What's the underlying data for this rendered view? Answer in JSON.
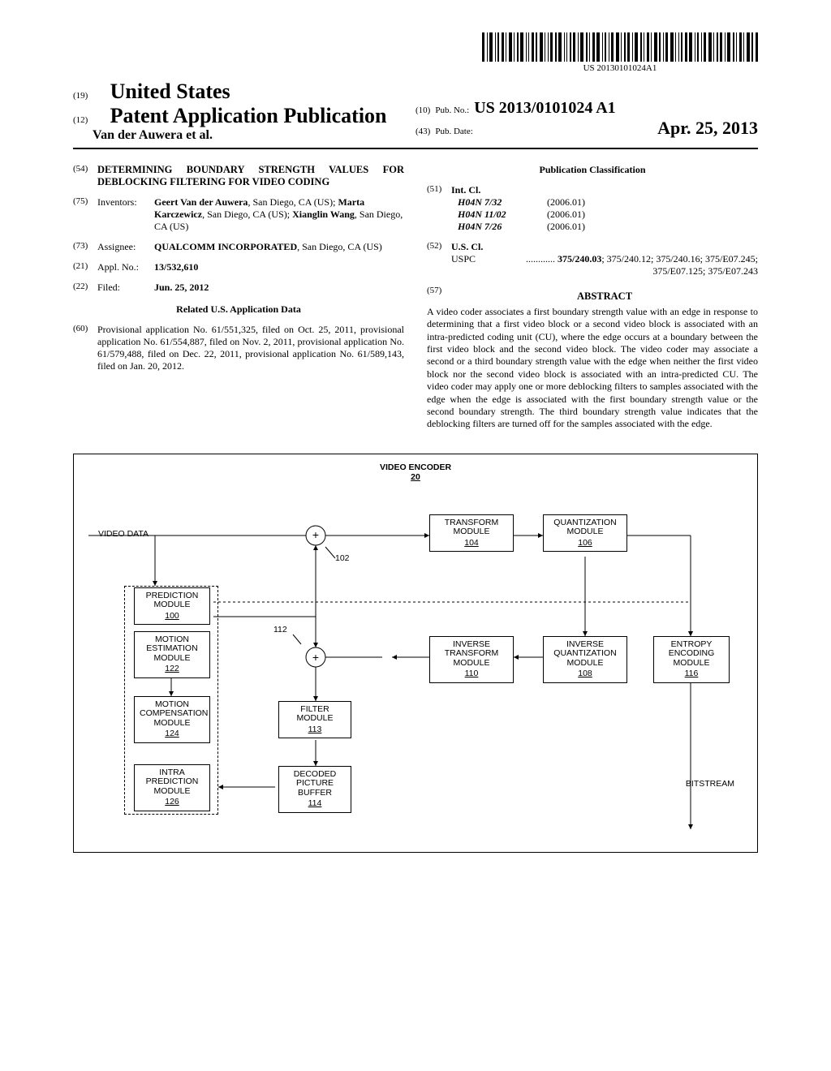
{
  "barcode_text": "US 20130101024A1",
  "header": {
    "idx19": "(19)",
    "us": "United States",
    "idx12": "(12)",
    "pap": "Patent Application Publication",
    "authors": "Van der Auwera et al.",
    "idx10": "(10)",
    "pubno_lbl": "Pub. No.:",
    "pubno": "US 2013/0101024 A1",
    "idx43": "(43)",
    "pubdate_lbl": "Pub. Date:",
    "pubdate": "Apr. 25, 2013"
  },
  "left": {
    "idx54": "(54)",
    "title": "DETERMINING BOUNDARY STRENGTH VALUES FOR DEBLOCKING FILTERING FOR VIDEO CODING",
    "idx75": "(75)",
    "inventors_lbl": "Inventors:",
    "inventors": "Geert Van der Auwera, San Diego, CA (US); Marta Karczewicz, San Diego, CA (US); Xianglin Wang, San Diego, CA (US)",
    "inv_b1": "Geert Van der Auwera",
    "inv_r1": ", San Diego, CA (US); ",
    "inv_b2": "Marta Karczewicz",
    "inv_r2": ", San Diego, CA (US); ",
    "inv_b3": "Xianglin Wang",
    "inv_r3": ", San Diego, CA (US)",
    "idx73": "(73)",
    "assignee_lbl": "Assignee:",
    "assignee_b": "QUALCOMM INCORPORATED",
    "assignee_r": ", San Diego, CA (US)",
    "idx21": "(21)",
    "applno_lbl": "Appl. No.:",
    "applno": "13/532,610",
    "idx22": "(22)",
    "filed_lbl": "Filed:",
    "filed": "Jun. 25, 2012",
    "related_hdr": "Related U.S. Application Data",
    "idx60": "(60)",
    "related": "Provisional application No. 61/551,325, filed on Oct. 25, 2011, provisional application No. 61/554,887, filed on Nov. 2, 2011, provisional application No. 61/579,488, filed on Dec. 22, 2011, provisional application No. 61/589,143, filed on Jan. 20, 2012."
  },
  "right": {
    "cls_hdr": "Publication Classification",
    "idx51": "(51)",
    "intcl_lbl": "Int. Cl.",
    "intcl": [
      {
        "code": "H04N 7/32",
        "yr": "(2006.01)"
      },
      {
        "code": "H04N 11/02",
        "yr": "(2006.01)"
      },
      {
        "code": "H04N 7/26",
        "yr": "(2006.01)"
      }
    ],
    "idx52": "(52)",
    "uscl_lbl": "U.S. Cl.",
    "uspc_lbl": "USPC",
    "uspc_dots": " ............ ",
    "uspc_b": "375/240.03",
    "uspc_rest": "; 375/240.12; 375/240.16; 375/E07.245; 375/E07.125; 375/E07.243",
    "idx57": "(57)",
    "abstract_hdr": "ABSTRACT",
    "abstract": "A video coder associates a first boundary strength value with an edge in response to determining that a first video block or a second video block is associated with an intra-predicted coding unit (CU), where the edge occurs at a boundary between the first video block and the second video block. The video coder may associate a second or a third boundary strength value with the edge when neither the first video block nor the second video block is associated with an intra-predicted CU. The video coder may apply one or more deblocking filters to samples associated with the edge when the edge is associated with the first boundary strength value or the second boundary strength. The third boundary strength value indicates that the deblocking filters are turned off for the samples associated with the edge."
  },
  "diagram": {
    "title": "VIDEO ENCODER",
    "title_num": "20",
    "video_data": "VIDEO DATA",
    "n102": "102",
    "n112": "112",
    "bitstream": "BITSTREAM",
    "blocks": {
      "prediction": {
        "t": "PREDICTION MODULE",
        "n": "100"
      },
      "motion_est": {
        "t": "MOTION ESTIMATION MODULE",
        "n": "122"
      },
      "motion_comp": {
        "t": "MOTION COMPENSATION MODULE",
        "n": "124"
      },
      "intra_pred": {
        "t": "INTRA PREDICTION MODULE",
        "n": "126"
      },
      "transform": {
        "t": "TRANSFORM MODULE",
        "n": "104"
      },
      "quant": {
        "t": "QUANTIZATION MODULE",
        "n": "106"
      },
      "inv_transform": {
        "t": "INVERSE TRANSFORM MODULE",
        "n": "110"
      },
      "inv_quant": {
        "t": "INVERSE QUANTIZATION MODULE",
        "n": "108"
      },
      "entropy": {
        "t": "ENTROPY ENCODING MODULE",
        "n": "116"
      },
      "filter": {
        "t": "FILTER MODULE",
        "n": "113"
      },
      "dpb": {
        "t": "DECODED PICTURE BUFFER",
        "n": "114"
      }
    }
  }
}
